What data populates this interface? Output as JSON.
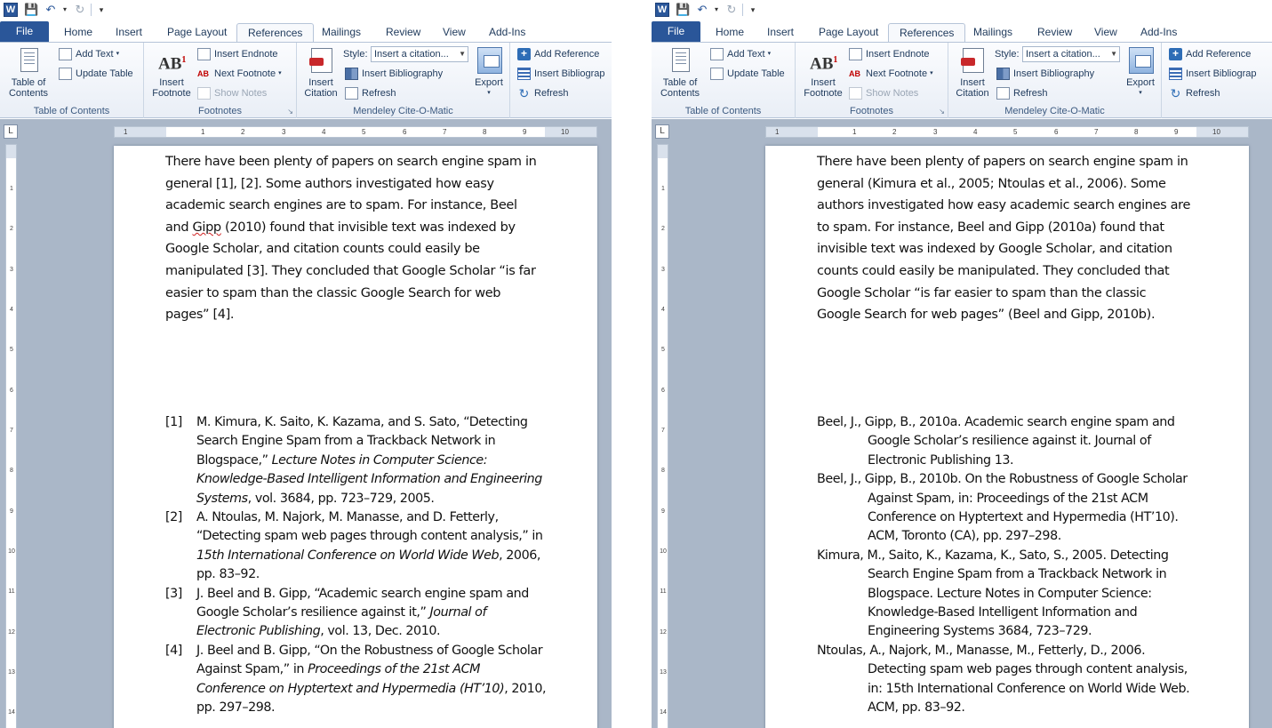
{
  "qat": {
    "word_letter": "W"
  },
  "tabs": [
    "File",
    "Home",
    "Insert",
    "Page Layout",
    "References",
    "Mailings",
    "Review",
    "View",
    "Add-Ins"
  ],
  "ribbon": {
    "toc": {
      "button": "Table of Contents",
      "add_text": "Add Text",
      "update_table": "Update Table",
      "label": "Table of Contents"
    },
    "footnotes": {
      "insert_footnote": "Insert Footnote",
      "ab": "AB",
      "insert_endnote": "Insert Endnote",
      "next_footnote": "Next Footnote",
      "show_notes": "Show Notes",
      "label": "Footnotes"
    },
    "mendeley": {
      "insert_citation": "Insert Citation",
      "style_label": "Style:",
      "style_value": "Insert a citation...",
      "insert_bibliography": "Insert Bibliography",
      "refresh": "Refresh",
      "export": "Export",
      "label": "Mendeley Cite-O-Matic"
    },
    "extra": {
      "add_reference": "Add Reference",
      "insert_bibliography": "Insert Bibliograp",
      "refresh": "Refresh"
    }
  },
  "ruler": {
    "h_ticks": [
      "1",
      "1",
      "2",
      "3",
      "4",
      "5",
      "6",
      "7",
      "8",
      "9",
      "10"
    ],
    "v_ticks": [
      "1",
      "2",
      "3",
      "4",
      "5",
      "6",
      "7",
      "8",
      "9",
      "10",
      "11",
      "12",
      "13",
      "14"
    ]
  },
  "left_doc": {
    "paragraph": [
      "There have been plenty of papers on search engine spam in",
      "general [1], [2]. Some authors investigated how easy",
      "academic search engines are to spam. For instance, Beel",
      "and ",
      "Gipp",
      " (2010) found that invisible text was indexed by",
      "Google Scholar, and citation counts could easily be",
      "manipulated [3]. They concluded that Google Scholar “is far",
      "easier to spam than the classic Google Search for web",
      "pages” [4]."
    ],
    "references": [
      {
        "num": "[1]",
        "a": "M. Kimura, K. Saito, K. Kazama, and S. Sato, “Detecting Search Engine Spam from a Trackback Network in Blogspace,” ",
        "i": "Lecture Notes in Computer Science: Knowledge-Based Intelligent Information and Engineering Systems",
        "b": ", vol. 3684, pp. 723–729, 2005."
      },
      {
        "num": "[2]",
        "a": "A. Ntoulas, M. Najork, M. Manasse, and D. Fetterly, “Detecting spam web pages through content analysis,” in ",
        "i": "15th International Conference on World Wide Web",
        "b": ", 2006, pp. 83–92."
      },
      {
        "num": "[3]",
        "a": "J. Beel and B. Gipp, “Academic search engine spam and Google Scholar’s resilience against it,” ",
        "i": "Journal of Electronic Publishing",
        "b": ", vol. 13, Dec. 2010."
      },
      {
        "num": "[4]",
        "a": "J. Beel and B. Gipp, “On the Robustness of Google Scholar Against Spam,” in ",
        "i": "Proceedings of the 21st ACM Conference on Hyptertext and Hypermedia (HT’10)",
        "b": ", 2010, pp. 297–298."
      }
    ]
  },
  "right_doc": {
    "paragraph": [
      "There have been plenty of papers on search engine spam in",
      "general (Kimura et al., 2005; Ntoulas et al., 2006). Some",
      "authors investigated how easy academic search engines are",
      "to spam. For instance, Beel and Gipp (2010a) found that",
      "invisible text was indexed by Google Scholar, and citation",
      "counts could easily be manipulated. They concluded that",
      "Google Scholar “is far easier to spam than the classic",
      "Google Search for web pages” (Beel and Gipp, 2010b)."
    ],
    "references": [
      "Beel, J., Gipp, B., 2010a. Academic search engine spam and Google Scholar’s resilience against it. Journal of Electronic Publishing 13.",
      "Beel, J., Gipp, B., 2010b. On the Robustness of Google Scholar Against Spam, in: Proceedings of the 21st ACM Conference on Hyptertext and Hypermedia (HT’10). ACM, Toronto (CA), pp. 297–298.",
      "Kimura, M., Saito, K., Kazama, K., Sato, S., 2005. Detecting Search Engine Spam from a Trackback Network in Blogspace. Lecture Notes in Computer Science: Knowledge-Based Intelligent Information and Engineering Systems 3684, 723–729.",
      "Ntoulas, A., Najork, M., Manasse, M., Fetterly, D., 2006. Detecting spam web pages through content analysis, in: 15th International Conference on World Wide Web. ACM, pp. 83–92."
    ]
  },
  "colors": {
    "file_tab": "#2a5699",
    "ribbon_border": "#b6c4d8",
    "workspace": "#aab7c8",
    "spellcheck": "#d02020"
  }
}
